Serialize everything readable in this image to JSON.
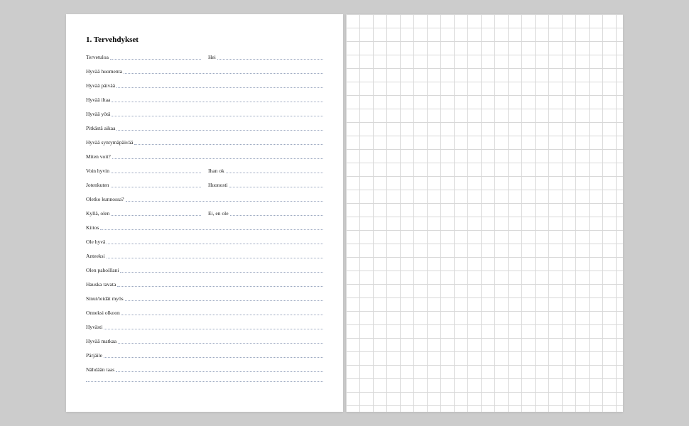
{
  "title": "1. Tervehdykset",
  "rows": [
    {
      "cols": [
        {
          "term": "Tervetuloa"
        },
        {
          "term": "Hei"
        }
      ]
    },
    {
      "cols": [
        {
          "term": "Hyvää huomenta"
        }
      ]
    },
    {
      "cols": [
        {
          "term": "Hyvää päivää"
        }
      ]
    },
    {
      "cols": [
        {
          "term": "Hyvää iltaa"
        }
      ]
    },
    {
      "cols": [
        {
          "term": "Hyvää yötä"
        }
      ]
    },
    {
      "cols": [
        {
          "term": "Pitkästä aikaa"
        }
      ]
    },
    {
      "cols": [
        {
          "term": "Hyvää syntymäpäivää"
        }
      ]
    },
    {
      "cols": [
        {
          "term": "Miten voit?"
        }
      ]
    },
    {
      "cols": [
        {
          "term": "Voin hyvin"
        },
        {
          "term": "Ihan ok"
        }
      ]
    },
    {
      "cols": [
        {
          "term": "Jotenkuten"
        },
        {
          "term": "Huonosti"
        }
      ]
    },
    {
      "cols": [
        {
          "term": "Oletko kunnossa?"
        }
      ]
    },
    {
      "cols": [
        {
          "term": "Kyllä, olen"
        },
        {
          "term": "Ei, en ole"
        }
      ]
    },
    {
      "cols": [
        {
          "term": "Kiitos"
        }
      ]
    },
    {
      "cols": [
        {
          "term": "Ole hyvä"
        }
      ]
    },
    {
      "cols": [
        {
          "term": "Anteeksi"
        }
      ]
    },
    {
      "cols": [
        {
          "term": "Olen pahoillani"
        }
      ]
    },
    {
      "cols": [
        {
          "term": "Hauska tavata"
        }
      ]
    },
    {
      "cols": [
        {
          "term": "Sinut/teidät myös"
        }
      ]
    },
    {
      "cols": [
        {
          "term": "Onneksi olkoon"
        }
      ]
    },
    {
      "cols": [
        {
          "term": "Hyvästi"
        }
      ]
    },
    {
      "cols": [
        {
          "term": "Hyvää matkaa"
        }
      ]
    },
    {
      "cols": [
        {
          "term": "Pärjäile"
        }
      ]
    },
    {
      "cols": [
        {
          "term": "Nähdään taas"
        }
      ]
    },
    {
      "cols": [
        {
          "term": ""
        }
      ]
    }
  ]
}
